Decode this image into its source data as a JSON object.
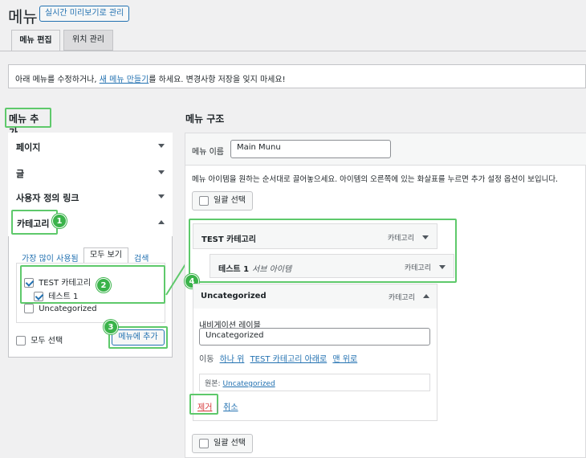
{
  "header": {
    "title": "메뉴",
    "live_preview_button": "실시간 미리보기로 관리"
  },
  "tabs": [
    {
      "label": "메뉴 편집"
    },
    {
      "label": "위치 관리"
    }
  ],
  "notice": {
    "before": "아래 메뉴를 수정하거나,",
    "link": "새 메뉴 만들기",
    "after": "를 하세요. 변경사항 저장을 잊지 마세요!"
  },
  "left": {
    "heading": "메뉴 추가",
    "sections": [
      {
        "label": "페이지"
      },
      {
        "label": "글"
      },
      {
        "label": "사용자 정의 링크"
      },
      {
        "label": "카테고리"
      }
    ],
    "subtabs": [
      {
        "label": "가장 많이 사용됨"
      },
      {
        "label": "모두 보기"
      },
      {
        "label": "검색"
      }
    ],
    "categories": [
      {
        "label": "TEST 카테고리",
        "checked": true
      },
      {
        "label": "테스트 1",
        "checked": true
      },
      {
        "label": "Uncategorized",
        "checked": false
      }
    ],
    "select_all": "모두 선택",
    "add_button": "메뉴에 추가"
  },
  "right": {
    "heading": "메뉴 구조",
    "menu_name_label": "메뉴 이름",
    "menu_name_value": "Main Munu",
    "instructions": "메뉴 아이템을 원하는 순서대로 끌어놓으세요. 아이템의 오른쪽에 있는 화살표를 누르면 추가 설정 옵션이 보입니다.",
    "bulk_select": "일괄 선택",
    "items": [
      {
        "title": "TEST 카테고리",
        "type": "카테고리"
      },
      {
        "title": "테스트 1",
        "subtitle": "서브 아이템",
        "type": "카테고리"
      },
      {
        "title": "Uncategorized",
        "type": "카테고리"
      }
    ],
    "expanded": {
      "nav_label": "내비게이션 레이블",
      "nav_value": "Uncategorized",
      "move_label": "이동",
      "move_links": [
        "하나 위",
        "TEST 카테고리 아래로",
        "맨 위로"
      ],
      "original_label": "원본:",
      "original_link": "Uncategorized",
      "remove": "제거",
      "separator": "|",
      "cancel": "취소"
    }
  },
  "annotations": [
    "1",
    "2",
    "3",
    "4"
  ],
  "colors": {
    "accent": "#2271b1",
    "highlight": "#5ec96b",
    "badge": "#3ab34a",
    "remove": "#d63638"
  }
}
